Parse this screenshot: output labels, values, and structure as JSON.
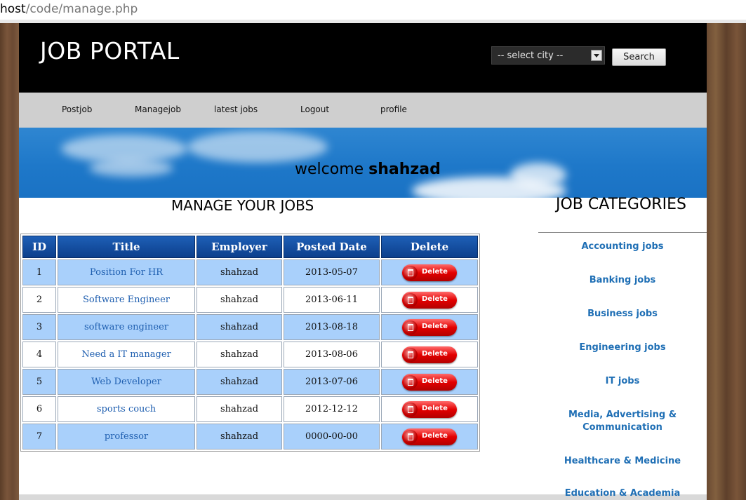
{
  "browser": {
    "url_host": "host",
    "url_path": "/code/manage.php"
  },
  "header": {
    "logo": "JOB PORTAL",
    "city_select": "-- select city --",
    "search_label": "Search"
  },
  "nav": [
    "Postjob",
    "Managejob",
    "latest jobs",
    "Logout",
    "profile"
  ],
  "banner": {
    "welcome_prefix": "welcome",
    "username": "shahzad"
  },
  "manage": {
    "title": "MANAGE YOUR JOBS",
    "columns": [
      "ID",
      "Title",
      "Employer",
      "Posted Date",
      "Delete"
    ],
    "delete_label": "Delete",
    "rows": [
      {
        "id": "1",
        "title": "Position For HR",
        "employer": "shahzad",
        "date": "2013-05-07"
      },
      {
        "id": "2",
        "title": "Software Engineer",
        "employer": "shahzad",
        "date": "2013-06-11"
      },
      {
        "id": "3",
        "title": "software engineer",
        "employer": "shahzad",
        "date": "2013-08-18"
      },
      {
        "id": "4",
        "title": "Need a IT manager",
        "employer": "shahzad",
        "date": "2013-08-06"
      },
      {
        "id": "5",
        "title": "Web Developer",
        "employer": "shahzad",
        "date": "2013-07-06"
      },
      {
        "id": "6",
        "title": "sports couch",
        "employer": "shahzad",
        "date": "2012-12-12"
      },
      {
        "id": "7",
        "title": "professor",
        "employer": "shahzad",
        "date": "0000-00-00"
      }
    ]
  },
  "categories": {
    "title": "JOB CATEGORIES",
    "items": [
      [
        "Accounting jobs"
      ],
      [
        "Banking jobs"
      ],
      [
        "Business jobs"
      ],
      [
        "Engineering jobs"
      ],
      [
        "IT jobs"
      ],
      [
        "Media, Advertising &",
        "Communication"
      ],
      [
        "Healthcare & Medicine"
      ],
      [
        "Education & Academia"
      ]
    ]
  },
  "colors": {
    "header_bg": "#000000",
    "nav_bg": "#cfcfcf",
    "table_header": "#0c3f8c",
    "row_highlight": "#a9d0fb",
    "link": "#1f6fb5",
    "delete_red": "#e30000"
  }
}
